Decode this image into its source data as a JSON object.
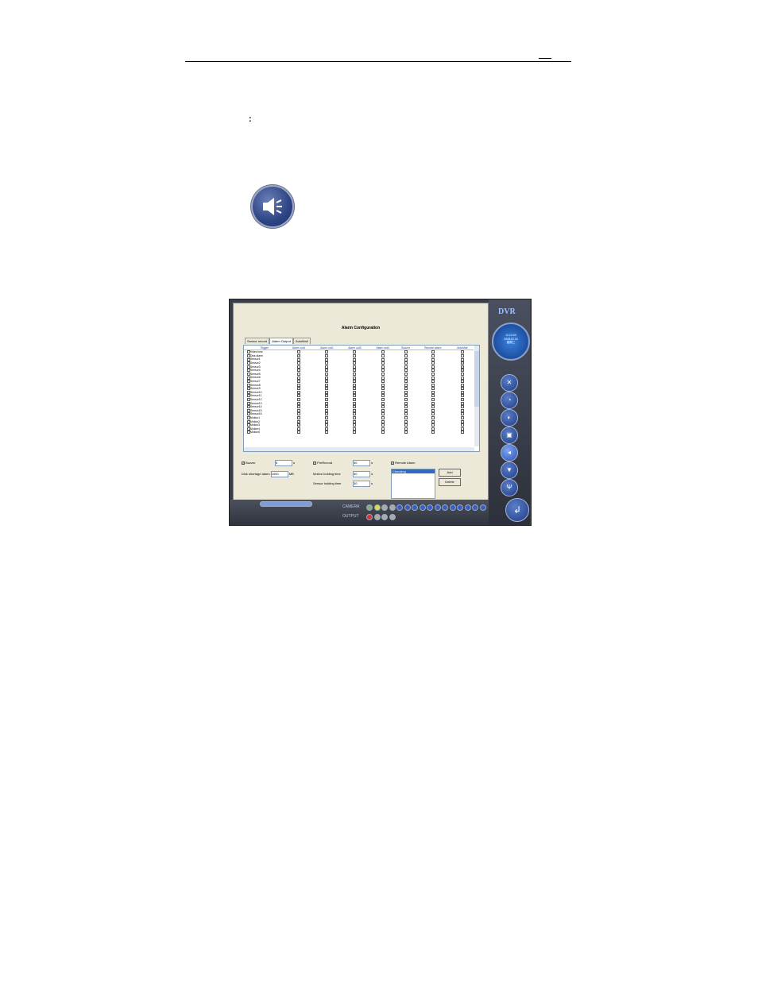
{
  "page": {
    "colon": ":"
  },
  "window": {
    "logo": "DVR",
    "clock": {
      "time": "11:12:00",
      "date": "2008.07.15",
      "day": "星期三"
    },
    "title": "Alarm Configuration",
    "tabs": [
      "Sensor record",
      "Alarm Output",
      "AutoMail"
    ],
    "columns": [
      "Trigger",
      "Alarm out1",
      "Alarm out2",
      "Alarm out3",
      "Alarm out4",
      "Buzzer",
      "Remote alarm",
      "AutoMail"
    ],
    "rows": [
      {
        "name": "Video loss",
        "checks": [
          false,
          false,
          false,
          false,
          false,
          false,
          false
        ]
      },
      {
        "name": "Disk alarm",
        "checks": [
          true,
          false,
          false,
          false,
          false,
          false,
          false
        ]
      },
      {
        "name": "Sensor1",
        "checks": [
          false,
          false,
          false,
          false,
          false,
          false,
          false
        ]
      },
      {
        "name": "Sensor2",
        "checks": [
          false,
          false,
          false,
          false,
          false,
          false,
          true
        ]
      },
      {
        "name": "Sensor3",
        "checks": [
          false,
          false,
          false,
          false,
          false,
          false,
          true
        ]
      },
      {
        "name": "Sensor4",
        "checks": [
          false,
          false,
          false,
          false,
          false,
          false,
          true
        ]
      },
      {
        "name": "Sensor5",
        "checks": [
          false,
          false,
          false,
          false,
          false,
          false,
          false
        ]
      },
      {
        "name": "Sensor6",
        "checks": [
          false,
          false,
          false,
          false,
          false,
          false,
          false
        ]
      },
      {
        "name": "Sensor7",
        "checks": [
          false,
          false,
          false,
          false,
          false,
          false,
          false
        ]
      },
      {
        "name": "Sensor8",
        "checks": [
          false,
          false,
          false,
          false,
          false,
          false,
          false
        ]
      },
      {
        "name": "Sensor9",
        "checks": [
          false,
          false,
          false,
          false,
          false,
          false,
          false
        ]
      },
      {
        "name": "Sensor10",
        "checks": [
          false,
          false,
          false,
          false,
          false,
          false,
          false
        ]
      },
      {
        "name": "Sensor11",
        "checks": [
          false,
          false,
          false,
          false,
          false,
          false,
          false
        ]
      },
      {
        "name": "Sensor12",
        "checks": [
          false,
          false,
          false,
          false,
          false,
          false,
          false
        ]
      },
      {
        "name": "Sensor13",
        "checks": [
          false,
          false,
          false,
          false,
          false,
          false,
          false
        ]
      },
      {
        "name": "Sensor14",
        "checks": [
          false,
          false,
          false,
          false,
          false,
          false,
          false
        ]
      },
      {
        "name": "Sensor15",
        "checks": [
          false,
          false,
          false,
          false,
          false,
          false,
          false
        ]
      },
      {
        "name": "Sensor16",
        "checks": [
          false,
          false,
          false,
          false,
          false,
          false,
          false
        ]
      },
      {
        "name": "Motion1",
        "checks": [
          false,
          false,
          false,
          false,
          false,
          false,
          false
        ]
      },
      {
        "name": "Motion2",
        "checks": [
          true,
          false,
          false,
          false,
          false,
          false,
          false
        ]
      },
      {
        "name": "Motion3",
        "checks": [
          true,
          false,
          false,
          false,
          false,
          false,
          false
        ]
      },
      {
        "name": "Motion4",
        "checks": [
          false,
          false,
          false,
          false,
          false,
          false,
          false
        ]
      },
      {
        "name": "Motion5",
        "checks": [
          false,
          false,
          false,
          false,
          false,
          false,
          false
        ]
      }
    ],
    "buzzer": {
      "label": "Buzzer",
      "value": "5",
      "unit": "s"
    },
    "disk_storage": {
      "label": "Disk shortage alarm",
      "value": "1000",
      "unit": "MB"
    },
    "prerecord": {
      "label": "PreRecord",
      "value": "30",
      "unit": "s"
    },
    "motion_holding": {
      "label": "Motion holding time",
      "value": "30",
      "unit": "s"
    },
    "sensor_holding": {
      "label": "Sensor holding time",
      "value": "30",
      "unit": "s"
    },
    "remote_alarm": {
      "label": "Remote Alarm",
      "list_item": "Checking"
    },
    "add_label": "Add",
    "delete_label": "Delete",
    "camera_label": "CAMERA",
    "output_label": "OUTPUT"
  }
}
